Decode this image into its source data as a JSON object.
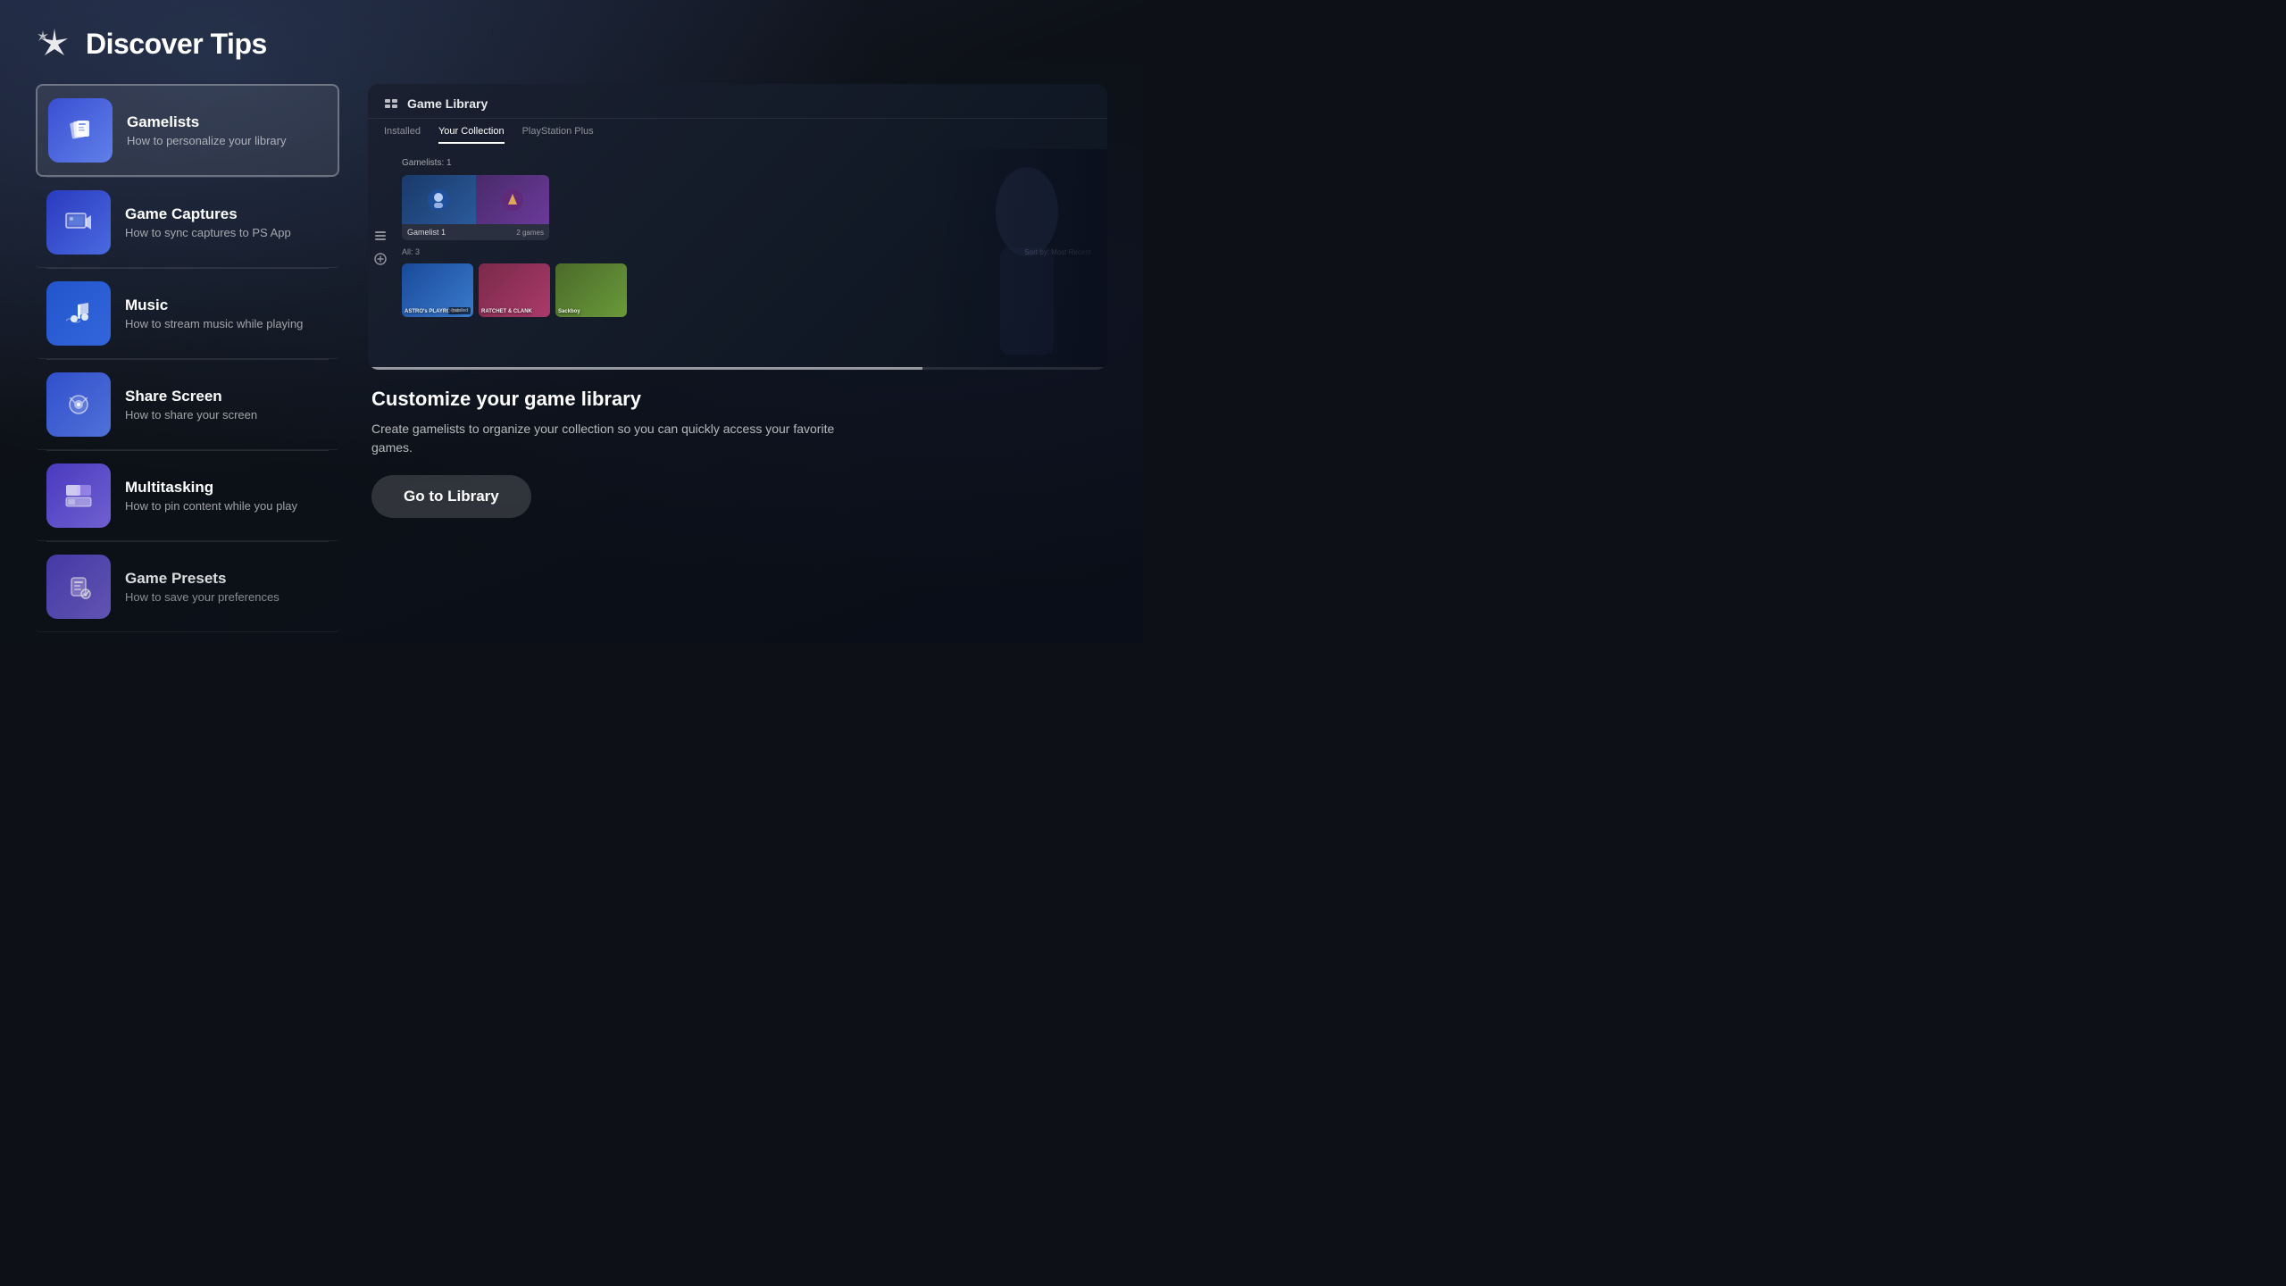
{
  "header": {
    "title": "Discover Tips",
    "icon": "sparkle-icon"
  },
  "tips": [
    {
      "id": "gamelists",
      "title": "Gamelists",
      "subtitle": "How to personalize your library",
      "active": true,
      "iconClass": "icon-gamelists"
    },
    {
      "id": "game-captures",
      "title": "Game Captures",
      "subtitle": "How to sync captures to PS App",
      "active": false,
      "iconClass": "icon-captures"
    },
    {
      "id": "music",
      "title": "Music",
      "subtitle": "How to stream music while playing",
      "active": false,
      "iconClass": "icon-music"
    },
    {
      "id": "share-screen",
      "title": "Share Screen",
      "subtitle": "How to share your screen",
      "active": false,
      "iconClass": "icon-share"
    },
    {
      "id": "multitasking",
      "title": "Multitasking",
      "subtitle": "How to pin content while you play",
      "active": false,
      "iconClass": "icon-multitasking"
    },
    {
      "id": "game-presets",
      "title": "Game Presets",
      "subtitle": "How to save your preferences",
      "active": false,
      "iconClass": "icon-presets"
    }
  ],
  "preview": {
    "library": {
      "title": "Game Library",
      "tabs": [
        "Installed",
        "Your Collection",
        "PlayStation Plus"
      ],
      "active_tab": "Your Collection",
      "section_label": "Gamelists: 1",
      "gamelist_name": "Gamelist 1",
      "gamelist_count": "2 games",
      "all_label": "All: 3",
      "sort_label": "Sort by: Most Recent",
      "games": [
        "ASTRO's PLAYROOM",
        "RATCHET & CLANK",
        "Sackboy"
      ]
    },
    "title": "Customize your game library",
    "description": "Create gamelists to organize your collection so you can quickly access your favorite games.",
    "cta_label": "Go to Library"
  }
}
